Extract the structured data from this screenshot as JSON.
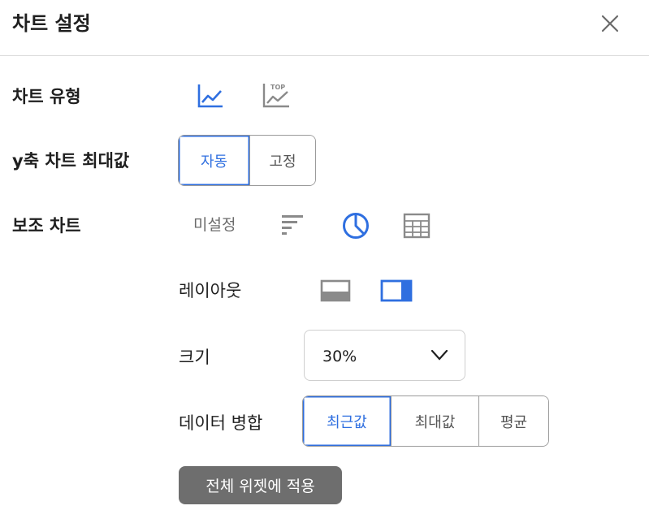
{
  "header": {
    "title": "차트 설정"
  },
  "chart_type": {
    "label": "차트 유형",
    "icons": [
      "line-chart-icon",
      "top-line-chart-icon"
    ],
    "top_badge": "TOP"
  },
  "y_max": {
    "label": "y축 차트 최대값",
    "options": [
      "자동",
      "고정"
    ],
    "selected": "자동"
  },
  "sub_chart": {
    "label": "보조 차트",
    "unset_label": "미설정",
    "icons": [
      "bar-list-icon",
      "pie-chart-icon",
      "table-icon"
    ],
    "selected": "pie-chart-icon",
    "layout": {
      "label": "레이아웃",
      "icons": [
        "layout-bottom-icon",
        "layout-right-icon"
      ],
      "selected": "layout-right-icon"
    },
    "size": {
      "label": "크기",
      "value": "30%"
    },
    "merge": {
      "label": "데이터 병합",
      "options": [
        "최근값",
        "최대값",
        "평균"
      ],
      "selected": "최근값"
    }
  },
  "apply_button": "전체 위젯에 적용",
  "colors": {
    "accent": "#2f6fe0",
    "icon_gray": "#8a8a8a",
    "button_gray": "#6e6e6e"
  }
}
